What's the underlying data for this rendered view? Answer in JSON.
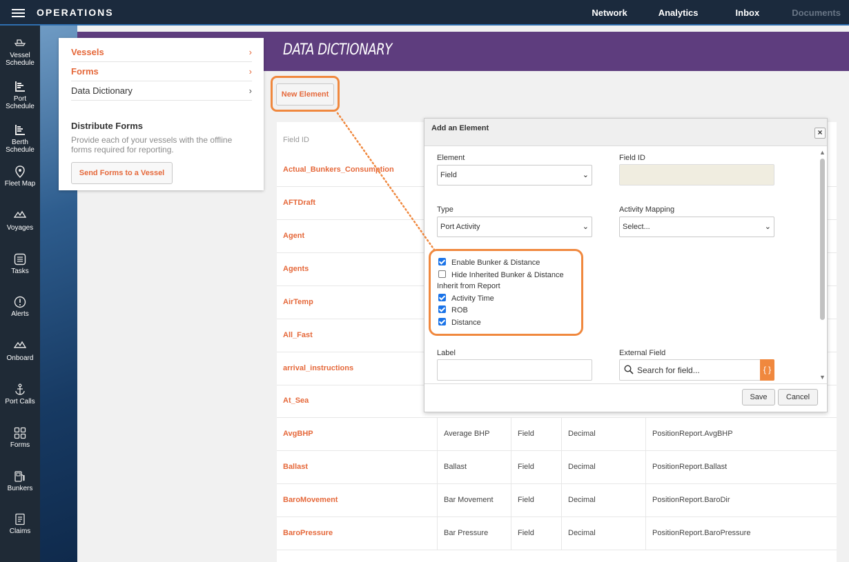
{
  "app": {
    "title": "OPERATIONS"
  },
  "topnav": [
    "Network",
    "Analytics",
    "Inbox",
    "Documents"
  ],
  "sidebar": [
    {
      "label_1": "Vessel",
      "label_2": "Schedule",
      "icon": "vessel-icon"
    },
    {
      "label_1": "Port",
      "label_2": "Schedule",
      "icon": "port-schedule-icon"
    },
    {
      "label_1": "Berth",
      "label_2": "Schedule",
      "icon": "berth-schedule-icon"
    },
    {
      "label_1": "Fleet Map",
      "label_2": "",
      "icon": "fleet-map-icon"
    },
    {
      "label_1": "Voyages",
      "label_2": "",
      "icon": "voyages-icon"
    },
    {
      "label_1": "Tasks",
      "label_2": "",
      "icon": "tasks-icon"
    },
    {
      "label_1": "Alerts",
      "label_2": "",
      "icon": "alerts-icon"
    },
    {
      "label_1": "Onboard",
      "label_2": "",
      "icon": "onboard-icon"
    },
    {
      "label_1": "Port Calls",
      "label_2": "",
      "icon": "anchor-icon"
    },
    {
      "label_1": "Forms",
      "label_2": "",
      "icon": "forms-icon"
    },
    {
      "label_1": "Bunkers",
      "label_2": "",
      "icon": "fuel-icon"
    },
    {
      "label_1": "Claims",
      "label_2": "",
      "icon": "claims-icon"
    }
  ],
  "page": {
    "title": "DATA DICTIONARY",
    "new_element": "New Element"
  },
  "menu": {
    "items": [
      {
        "label": "Vessels",
        "chevron": "›"
      },
      {
        "label": "Forms",
        "chevron": "›"
      },
      {
        "label": "Data Dictionary",
        "chevron": "›"
      }
    ],
    "distribute_title": "Distribute Forms",
    "distribute_desc": "Provide each of your vessels with the offline forms required for reporting.",
    "send_button": "Send Forms to a Vessel"
  },
  "table": {
    "header_field_id": "Field ID",
    "rows": [
      {
        "id": "Actual_Bunkers_Consumption"
      },
      {
        "id": "AFTDraft"
      },
      {
        "id": "Agent"
      },
      {
        "id": "Agents"
      },
      {
        "id": "AirTemp"
      },
      {
        "id": "All_Fast"
      },
      {
        "id": "arrival_instructions"
      },
      {
        "id": "At_Sea"
      },
      {
        "id": "AvgBHP",
        "label": "Average BHP",
        "element": "Field",
        "type": "Decimal",
        "external": "PositionReport.AvgBHP"
      },
      {
        "id": "Ballast",
        "label": "Ballast",
        "element": "Field",
        "type": "Decimal",
        "external": "PositionReport.Ballast"
      },
      {
        "id": "BaroMovement",
        "label": "Bar Movement",
        "element": "Field",
        "type": "Decimal",
        "external": "PositionReport.BaroDir"
      },
      {
        "id": "BaroPressure",
        "label": "Bar Pressure",
        "element": "Field",
        "type": "Decimal",
        "external": "PositionReport.BaroPressure"
      }
    ]
  },
  "dialog": {
    "title": "Add an Element",
    "close": "×",
    "element_label": "Element",
    "element_value": "Field",
    "field_id_label": "Field ID",
    "field_id_value": "",
    "type_label": "Type",
    "type_value": "Port Activity",
    "activity_mapping_label": "Activity Mapping",
    "activity_mapping_value": "Select...",
    "enable_bunker": "Enable Bunker & Distance",
    "hide_inherited": "Hide Inherited Bunker & Distance",
    "inherit_from_report": "Inherit from Report",
    "activity_time": "Activity Time",
    "rob": "ROB",
    "distance": "Distance",
    "label_label": "Label",
    "label_value": "",
    "external_field_label": "External Field",
    "search_placeholder": "Search for field...",
    "brace_button": "{ }",
    "save": "Save",
    "cancel": "Cancel",
    "scroll_up": "▲",
    "scroll_down": "▼",
    "caret": "⌄",
    "checks": {
      "enable_bunker": true,
      "hide_inherited": false,
      "activity_time": true,
      "rob": true,
      "distance": true
    }
  },
  "colors": {
    "accent": "#e5683a",
    "header_band": "#5e3d7e",
    "topbar": "#1b2a3d",
    "highlight": "#f0883e",
    "checkbox": "#1a73e8"
  }
}
